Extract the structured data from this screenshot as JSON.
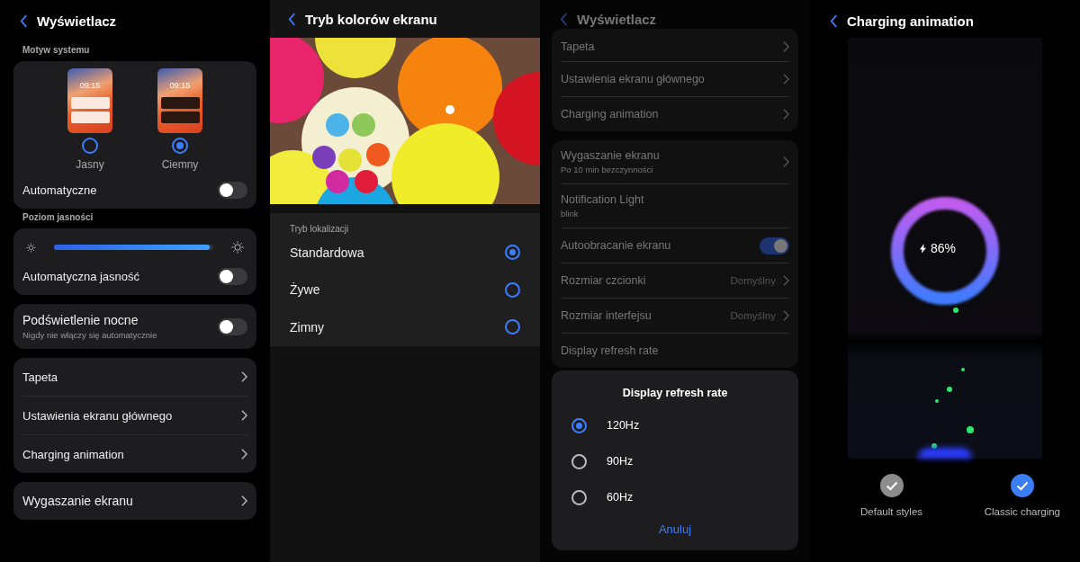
{
  "screens": [
    {
      "kind": "display_settings",
      "title": "Wyświetlacz",
      "theme_section": "Motyw systemu",
      "themes": [
        {
          "label": "Jasny",
          "time": "09:15",
          "selected": false
        },
        {
          "label": "Ciemny",
          "time": "09:15",
          "selected": true
        }
      ],
      "auto_theme": {
        "label": "Automatyczne",
        "on": false
      },
      "brightness_section": "Poziom jasności",
      "brightness": {
        "level": 0.98
      },
      "auto_brightness": {
        "label": "Automatyczna jasność",
        "on": false
      },
      "night_light": {
        "label": "Podświetlenie nocne",
        "subtitle": "Nigdy nie włączy się automatycznie",
        "on": false
      },
      "links": [
        {
          "label": "Tapeta"
        },
        {
          "label": "Ustawienia ekranu głównego"
        },
        {
          "label": "Charging animation"
        }
      ],
      "more_links": [
        {
          "label": "Wygaszanie ekranu"
        }
      ]
    },
    {
      "kind": "color_mode",
      "title": "Tryb kolorów ekranu",
      "section": "Tryb lokalizacji",
      "options": [
        {
          "label": "Standardowa",
          "selected": true
        },
        {
          "label": "Żywe",
          "selected": false
        },
        {
          "label": "Zimny",
          "selected": false
        }
      ]
    },
    {
      "kind": "display_dialog",
      "title": "Wyświetlacz",
      "groups": [
        [
          {
            "kind": "link",
            "label": "Tapeta"
          },
          {
            "kind": "link",
            "label": "Ustawienia ekranu głównego"
          },
          {
            "kind": "link",
            "label": "Charging animation"
          }
        ],
        [
          {
            "kind": "link",
            "label": "Wygaszanie ekranu",
            "subtitle": "Po 10 min bezczynności"
          },
          {
            "kind": "info",
            "label": "Notification Light",
            "subtitle": "blink"
          },
          {
            "kind": "toggle",
            "label": "Autoobracanie ekranu",
            "on": true
          },
          {
            "kind": "value",
            "label": "Rozmiar czcionki",
            "value": "Domyślny"
          },
          {
            "kind": "value",
            "label": "Rozmiar interfejsu",
            "value": "Domyślny"
          },
          {
            "kind": "info",
            "label": "Display refresh rate"
          }
        ]
      ],
      "dialog": {
        "title": "Display refresh rate",
        "options": [
          {
            "label": "120Hz",
            "selected": true
          },
          {
            "label": "90Hz",
            "selected": false
          },
          {
            "label": "60Hz",
            "selected": false
          }
        ],
        "cancel": "Anuluj"
      }
    },
    {
      "kind": "charging",
      "title": "Charging animation",
      "percent": "86%",
      "styles": [
        {
          "label": "Default styles",
          "selected": false
        },
        {
          "label": "Classic charging",
          "selected": true
        }
      ]
    }
  ]
}
